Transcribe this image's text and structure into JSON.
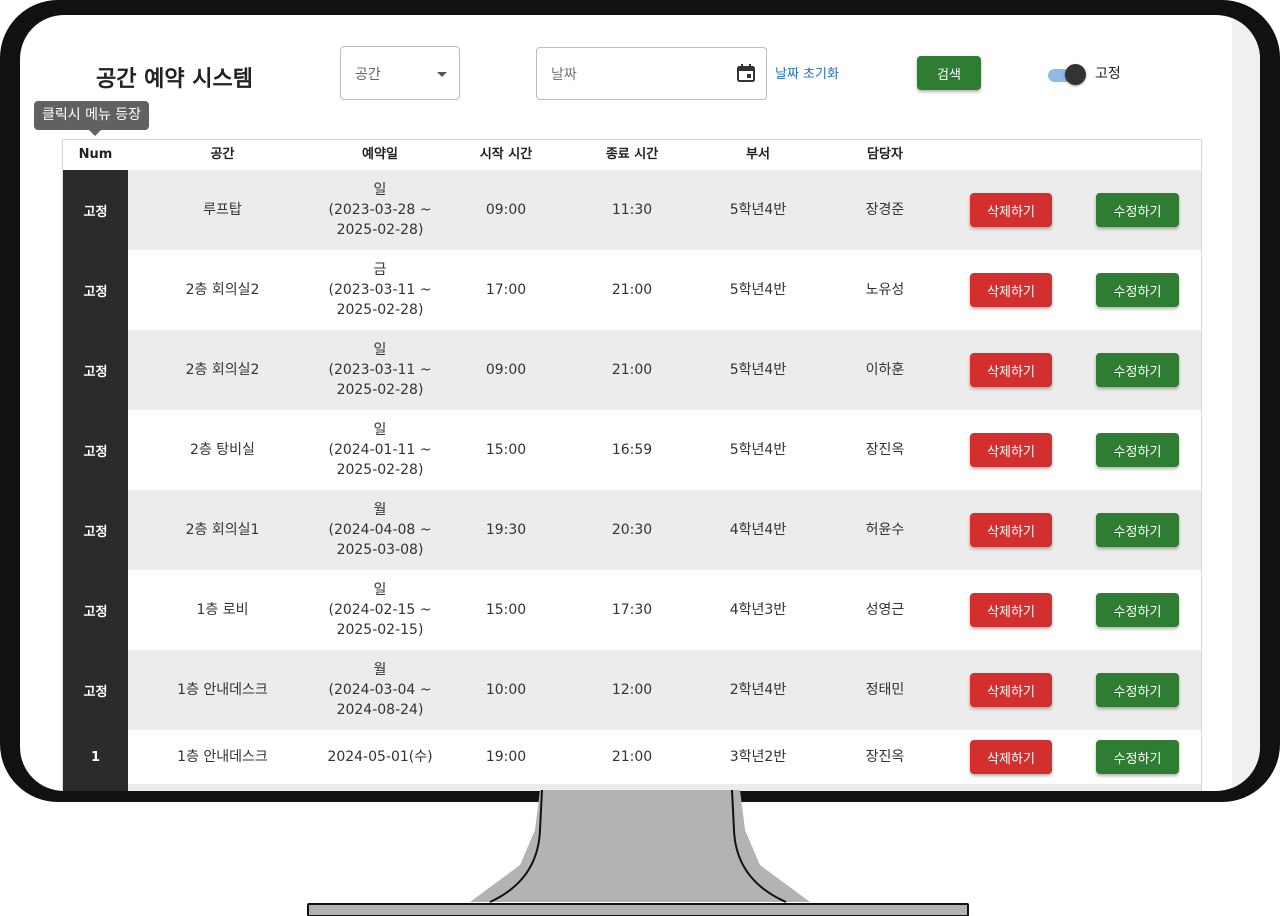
{
  "header": {
    "title": "공간 예약 시스템",
    "space_select_label": "공간",
    "date_label": "날짜",
    "reset_date_label": "날짜 초기화",
    "search_label": "검색",
    "toggle_label": "고정",
    "toggle_on": true
  },
  "tooltip": "클릭시 메뉴 등장",
  "table": {
    "columns": [
      "Num",
      "공간",
      "예약일",
      "시작 시간",
      "종료 시간",
      "부서",
      "담당자"
    ],
    "delete_label": "삭제하기",
    "edit_label": "수정하기",
    "rows": [
      {
        "num": "고정",
        "space": "루프탑",
        "day": "일",
        "range": "(2023-03-28 ~",
        "range_end": "2025-02-28)",
        "start": "09:00",
        "end": "11:30",
        "dept": "5학년4반",
        "manager": "장경준"
      },
      {
        "num": "고정",
        "space": "2층 회의실2",
        "day": "금",
        "range": "(2023-03-11 ~",
        "range_end": "2025-02-28)",
        "start": "17:00",
        "end": "21:00",
        "dept": "5학년4반",
        "manager": "노유성"
      },
      {
        "num": "고정",
        "space": "2층 회의실2",
        "day": "일",
        "range": "(2023-03-11 ~",
        "range_end": "2025-02-28)",
        "start": "09:00",
        "end": "21:00",
        "dept": "5학년4반",
        "manager": "이하훈"
      },
      {
        "num": "고정",
        "space": "2층 탕비실",
        "day": "일",
        "range": "(2024-01-11 ~",
        "range_end": "2025-02-28)",
        "start": "15:00",
        "end": "16:59",
        "dept": "5학년4반",
        "manager": "장진옥"
      },
      {
        "num": "고정",
        "space": "2층 회의실1",
        "day": "월",
        "range": "(2024-04-08 ~",
        "range_end": "2025-03-08)",
        "start": "19:30",
        "end": "20:30",
        "dept": "4학년4반",
        "manager": "허윤수"
      },
      {
        "num": "고정",
        "space": "1층 로비",
        "day": "일",
        "range": "(2024-02-15 ~",
        "range_end": "2025-02-15)",
        "start": "15:00",
        "end": "17:30",
        "dept": "4학년3반",
        "manager": "성영근"
      },
      {
        "num": "고정",
        "space": "1층 안내데스크",
        "day": "월",
        "range": "(2024-03-04 ~",
        "range_end": "2024-08-24)",
        "start": "10:00",
        "end": "12:00",
        "dept": "2학년4반",
        "manager": "정태민"
      },
      {
        "num": "1",
        "space": "1층 안내데스크",
        "date": "2024-05-01(수)",
        "start": "19:00",
        "end": "21:00",
        "dept": "3학년2반",
        "manager": "장진옥"
      }
    ]
  }
}
